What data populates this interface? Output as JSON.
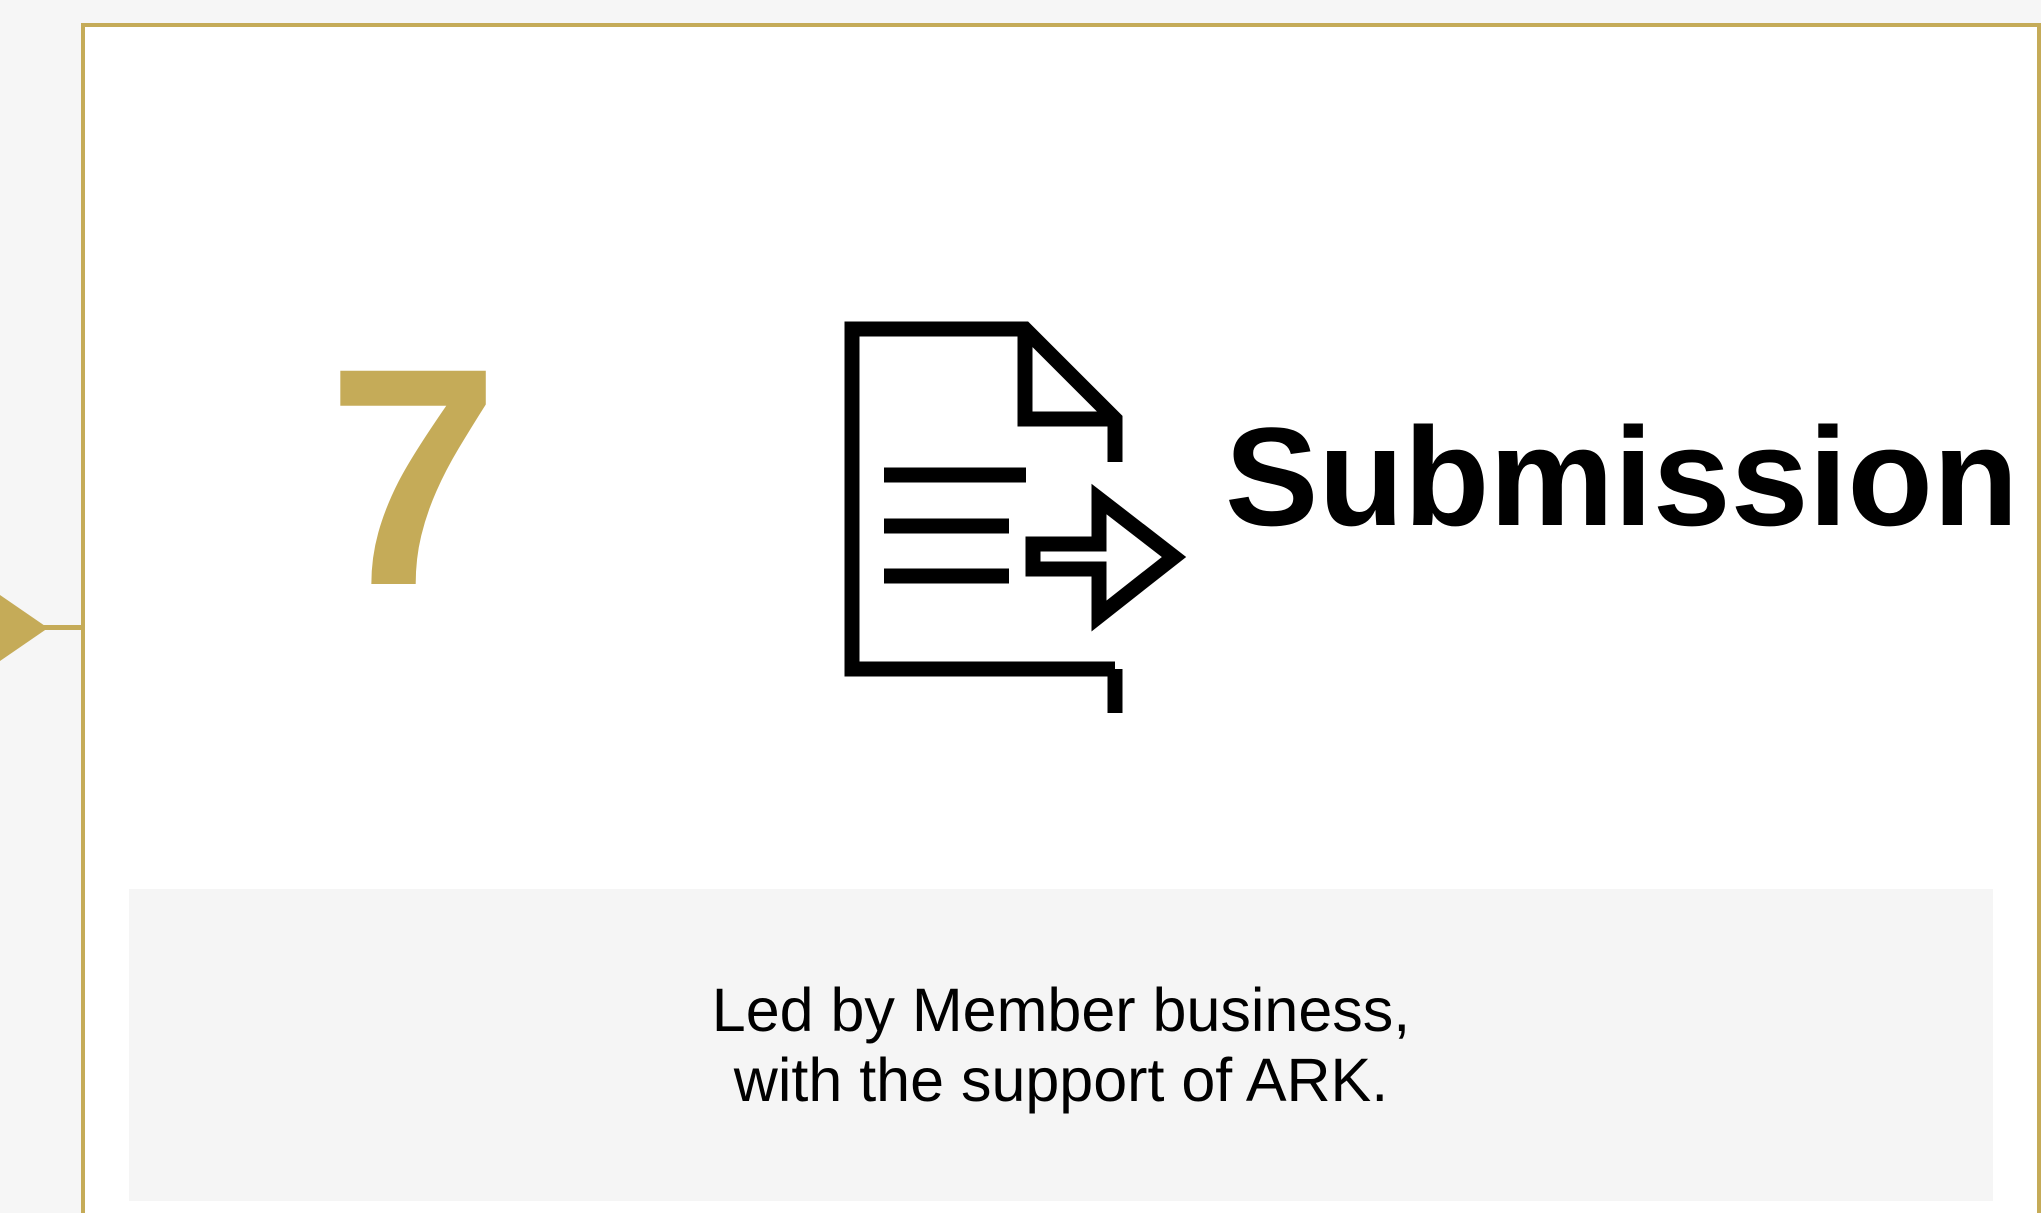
{
  "step": {
    "number": "7",
    "title": "Submission",
    "icon": "document-arrow-icon",
    "description_lines": [
      "Led by Member business,",
      "with the support of ARK."
    ]
  },
  "colors": {
    "accent": "#c5ab58",
    "panel": "#f5f5f5",
    "background": "#f6f6f6",
    "text": "#000000"
  }
}
